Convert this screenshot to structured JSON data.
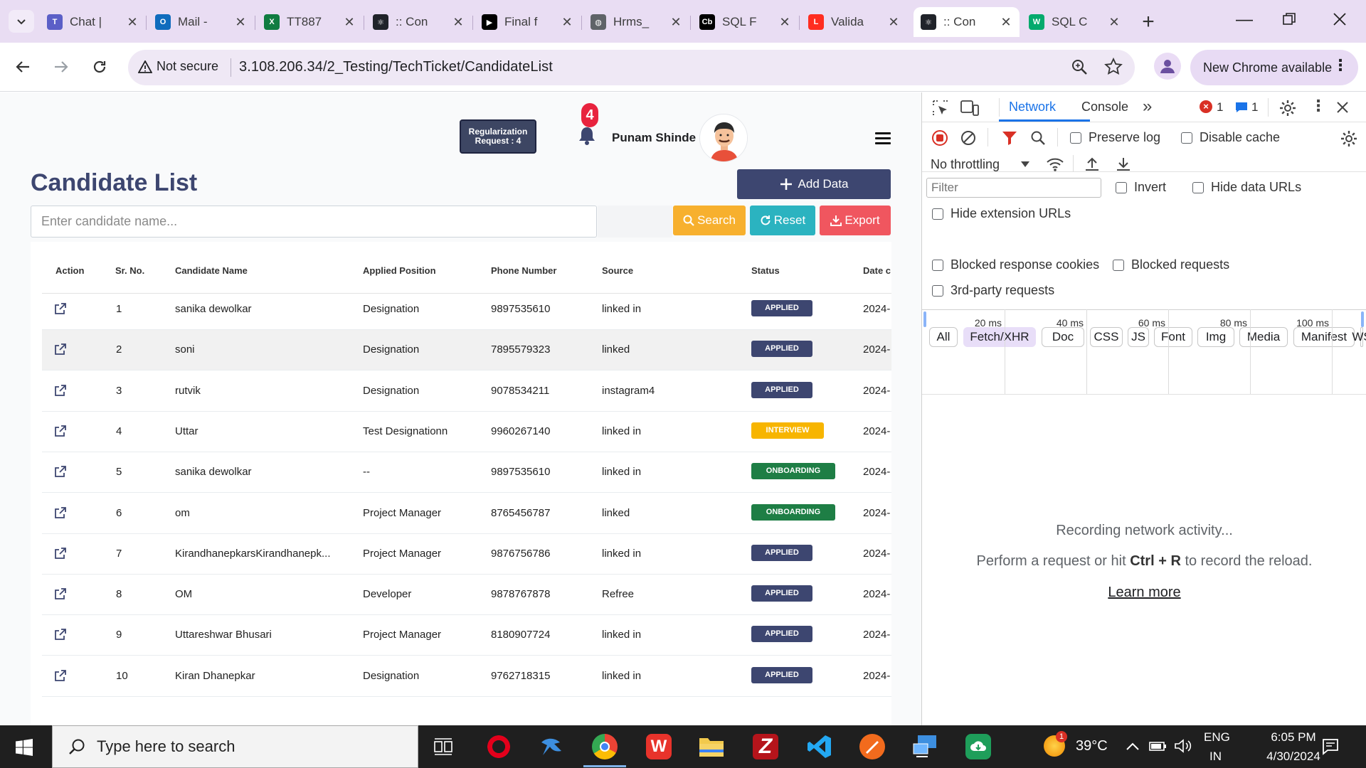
{
  "browser": {
    "tabs": [
      {
        "title": "Chat |",
        "icon": "teams-icon",
        "color": "#5b5fc7",
        "glyph": "T"
      },
      {
        "title": "Mail -",
        "icon": "outlook-icon",
        "color": "#0f6cbd",
        "glyph": "O"
      },
      {
        "title": "TT887",
        "icon": "excel-icon",
        "color": "#107c41",
        "glyph": "X"
      },
      {
        "title": ":: Con",
        "icon": "react-icon",
        "color": "#20232a",
        "glyph": "⚛"
      },
      {
        "title": "Final f",
        "icon": "play-icon",
        "color": "#000000",
        "glyph": "▶"
      },
      {
        "title": "Hrms_",
        "icon": "globe-icon",
        "color": "#5f6368",
        "glyph": "◍"
      },
      {
        "title": "SQL F",
        "icon": "cb-icon",
        "color": "#000000",
        "glyph": "Cb"
      },
      {
        "title": "Valida",
        "icon": "laravel-icon",
        "color": "#ff2d20",
        "glyph": "L"
      },
      {
        "title": ":: Con",
        "icon": "react-icon",
        "color": "#20232a",
        "glyph": "⚛"
      },
      {
        "title": "SQL C",
        "icon": "w3schools-icon",
        "color": "#04aa6d",
        "glyph": "W"
      }
    ],
    "address": {
      "security_label": "Not secure",
      "url": "3.108.206.34/2_Testing/TechTicket/CandidateList"
    },
    "new_chrome_label": "New Chrome available"
  },
  "app": {
    "regularization_line1": "Regularization",
    "regularization_line2": "Request : 4",
    "notification_count": "4",
    "user_name": "Punam Shinde",
    "page_title": "Candidate List",
    "add_data_label": "Add Data",
    "search_placeholder": "Enter candidate name...",
    "search_label": "Search",
    "reset_label": "Reset",
    "export_label": "Export",
    "columns": [
      "Action",
      "Sr. No.",
      "Candidate Name",
      "Applied Position",
      "Phone Number",
      "Source",
      "Status",
      "Date c"
    ],
    "rows": [
      {
        "sr": "1",
        "name": "sanika dewolkar",
        "position": "Designation",
        "phone": "9897535610",
        "source": "linked in",
        "status": "APPLIED",
        "date": "2024-"
      },
      {
        "sr": "2",
        "name": "soni",
        "position": "Designation",
        "phone": "7895579323",
        "source": "linked",
        "status": "APPLIED",
        "date": "2024-"
      },
      {
        "sr": "3",
        "name": "rutvik",
        "position": "Designation",
        "phone": "9078534211",
        "source": "instagram4",
        "status": "APPLIED",
        "date": "2024-"
      },
      {
        "sr": "4",
        "name": "Uttar",
        "position": "Test Designationn",
        "phone": "9960267140",
        "source": "linked in",
        "status": "INTERVIEW",
        "date": "2024-"
      },
      {
        "sr": "5",
        "name": "sanika dewolkar",
        "position": "--",
        "phone": "9897535610",
        "source": "linked in",
        "status": "ONBOARDING",
        "date": "2024-"
      },
      {
        "sr": "6",
        "name": "om",
        "position": "Project Manager",
        "phone": "8765456787",
        "source": "linked",
        "status": "ONBOARDING",
        "date": "2024-"
      },
      {
        "sr": "7",
        "name": "KirandhanepkarsKirandhanepk...",
        "position": "Project Manager",
        "phone": "9876756786",
        "source": "linked in",
        "status": "APPLIED",
        "date": "2024-"
      },
      {
        "sr": "8",
        "name": "OM",
        "position": "Developer",
        "phone": "9878767878",
        "source": "Refree",
        "status": "APPLIED",
        "date": "2024-"
      },
      {
        "sr": "9",
        "name": "Uttareshwar Bhusari",
        "position": "Project Manager",
        "phone": "8180907724",
        "source": "linked in",
        "status": "APPLIED",
        "date": "2024-"
      },
      {
        "sr": "10",
        "name": "Kiran Dhanepkar",
        "position": "Designation",
        "phone": "9762718315",
        "source": "linked in",
        "status": "APPLIED",
        "date": "2024-"
      }
    ],
    "status_colors": {
      "APPLIED": "#3d4670",
      "INTERVIEW": "#f7b500",
      "ONBOARDING": "#1e7e45"
    }
  },
  "devtools": {
    "tabs": [
      "Network",
      "Console"
    ],
    "active_tab": "Network",
    "error_count": "1",
    "message_count": "1",
    "preserve_log": "Preserve log",
    "disable_cache": "Disable cache",
    "throttling": "No throttling",
    "filter_placeholder": "Filter",
    "invert": "Invert",
    "hide_data_urls": "Hide data URLs",
    "hide_extension_urls": "Hide extension URLs",
    "types": [
      "All",
      "Fetch/XHR",
      "Doc",
      "CSS",
      "JS",
      "Font",
      "Img",
      "Media",
      "Manifest",
      "WS"
    ],
    "selected_type": "Fetch/XHR",
    "blocked_response_cookies": "Blocked response cookies",
    "blocked_requests": "Blocked requests",
    "third_party": "3rd-party requests",
    "timeline_ticks": [
      "20 ms",
      "40 ms",
      "60 ms",
      "80 ms",
      "100 ms"
    ],
    "recording_title": "Recording network activity...",
    "recording_hint_pre": "Perform a request or hit ",
    "recording_hint_key": "Ctrl + R",
    "recording_hint_post": " to record the reload.",
    "learn_more": "Learn more"
  },
  "taskbar": {
    "search_placeholder": "Type here to search",
    "weather": "39°C",
    "weather_badge": "1",
    "lang_line1": "ENG",
    "lang_line2": "IN",
    "time": "6:05 PM",
    "date": "4/30/2024"
  }
}
